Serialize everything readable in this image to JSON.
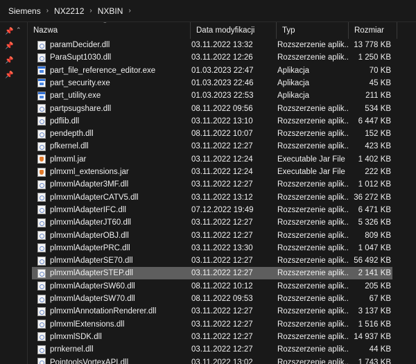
{
  "breadcrumb": {
    "items": [
      "Siemens",
      "NX2212",
      "NXBIN"
    ],
    "separator": "›"
  },
  "columns": {
    "name": "Nazwa",
    "date": "Data modyfikacji",
    "type": "Typ",
    "size": "Rozmiar"
  },
  "colors": {
    "background": "#191919",
    "selected_row": "#5e5e5e",
    "text": "#f0f0f0"
  },
  "selected_index": 18,
  "files": [
    {
      "name": "paramDecider.dll",
      "date": "03.11.2022 13:32",
      "type": "Rozszerzenie aplik...",
      "size": "13 778 KB",
      "icon": "dll-file-icon"
    },
    {
      "name": "ParaSupt1030.dll",
      "date": "03.11.2022 12:26",
      "type": "Rozszerzenie aplik...",
      "size": "1 250 KB",
      "icon": "dll-file-icon"
    },
    {
      "name": "part_file_reference_editor.exe",
      "date": "01.03.2023 22:47",
      "type": "Aplikacja",
      "size": "70 KB",
      "icon": "exe-file-icon"
    },
    {
      "name": "part_security.exe",
      "date": "01.03.2023 22:46",
      "type": "Aplikacja",
      "size": "45 KB",
      "icon": "exe-file-icon"
    },
    {
      "name": "part_utility.exe",
      "date": "01.03.2023 22:53",
      "type": "Aplikacja",
      "size": "211 KB",
      "icon": "exe-file-icon"
    },
    {
      "name": "partpsugshare.dll",
      "date": "08.11.2022 09:56",
      "type": "Rozszerzenie aplik...",
      "size": "534 KB",
      "icon": "dll-file-icon"
    },
    {
      "name": "pdflib.dll",
      "date": "03.11.2022 13:10",
      "type": "Rozszerzenie aplik...",
      "size": "6 447 KB",
      "icon": "dll-file-icon"
    },
    {
      "name": "pendepth.dll",
      "date": "08.11.2022 10:07",
      "type": "Rozszerzenie aplik...",
      "size": "152 KB",
      "icon": "dll-file-icon"
    },
    {
      "name": "pfkernel.dll",
      "date": "03.11.2022 12:27",
      "type": "Rozszerzenie aplik...",
      "size": "423 KB",
      "icon": "dll-file-icon"
    },
    {
      "name": "plmxml.jar",
      "date": "03.11.2022 12:24",
      "type": "Executable Jar File",
      "size": "1 402 KB",
      "icon": "jar-file-icon"
    },
    {
      "name": "plmxml_extensions.jar",
      "date": "03.11.2022 12:24",
      "type": "Executable Jar File",
      "size": "222 KB",
      "icon": "jar-file-icon"
    },
    {
      "name": "plmxmlAdapter3MF.dll",
      "date": "03.11.2022 12:27",
      "type": "Rozszerzenie aplik...",
      "size": "1 012 KB",
      "icon": "dll-file-icon"
    },
    {
      "name": "plmxmlAdapterCATV5.dll",
      "date": "03.11.2022 13:12",
      "type": "Rozszerzenie aplik...",
      "size": "36 272 KB",
      "icon": "dll-file-icon"
    },
    {
      "name": "plmxmlAdapterIFC.dll",
      "date": "07.12.2022 19:49",
      "type": "Rozszerzenie aplik...",
      "size": "6 471 KB",
      "icon": "dll-file-icon"
    },
    {
      "name": "plmxmlAdapterJT60.dll",
      "date": "03.11.2022 12:27",
      "type": "Rozszerzenie aplik...",
      "size": "5 326 KB",
      "icon": "dll-file-icon"
    },
    {
      "name": "plmxmlAdapterOBJ.dll",
      "date": "03.11.2022 12:27",
      "type": "Rozszerzenie aplik...",
      "size": "809 KB",
      "icon": "dll-file-icon"
    },
    {
      "name": "plmxmlAdapterPRC.dll",
      "date": "03.11.2022 13:30",
      "type": "Rozszerzenie aplik...",
      "size": "1 047 KB",
      "icon": "dll-file-icon"
    },
    {
      "name": "plmxmlAdapterSE70.dll",
      "date": "03.11.2022 12:27",
      "type": "Rozszerzenie aplik...",
      "size": "56 492 KB",
      "icon": "dll-file-icon"
    },
    {
      "name": "plmxmlAdapterSTEP.dll",
      "date": "03.11.2022 12:27",
      "type": "Rozszerzenie aplik...",
      "size": "2 141 KB",
      "icon": "dll-file-icon"
    },
    {
      "name": "plmxmlAdapterSW60.dll",
      "date": "08.11.2022 10:12",
      "type": "Rozszerzenie aplik...",
      "size": "205 KB",
      "icon": "dll-file-icon"
    },
    {
      "name": "plmxmlAdapterSW70.dll",
      "date": "08.11.2022 09:53",
      "type": "Rozszerzenie aplik...",
      "size": "67 KB",
      "icon": "dll-file-icon"
    },
    {
      "name": "plmxmlAnnotationRenderer.dll",
      "date": "03.11.2022 12:27",
      "type": "Rozszerzenie aplik...",
      "size": "3 137 KB",
      "icon": "dll-file-icon"
    },
    {
      "name": "plmxmlExtensions.dll",
      "date": "03.11.2022 12:27",
      "type": "Rozszerzenie aplik...",
      "size": "1 516 KB",
      "icon": "dll-file-icon"
    },
    {
      "name": "plmxmlSDK.dll",
      "date": "03.11.2022 12:27",
      "type": "Rozszerzenie aplik...",
      "size": "14 937 KB",
      "icon": "dll-file-icon"
    },
    {
      "name": "prnkernel.dll",
      "date": "03.11.2022 12:27",
      "type": "Rozszerzenie aplik...",
      "size": "44 KB",
      "icon": "dll-file-icon"
    },
    {
      "name": "PointoolsVortexAPI.dll",
      "date": "03.11.2022 13:02",
      "type": "Rozszerzenie aplik...",
      "size": "1 743 KB",
      "icon": "dll-file-icon"
    }
  ]
}
